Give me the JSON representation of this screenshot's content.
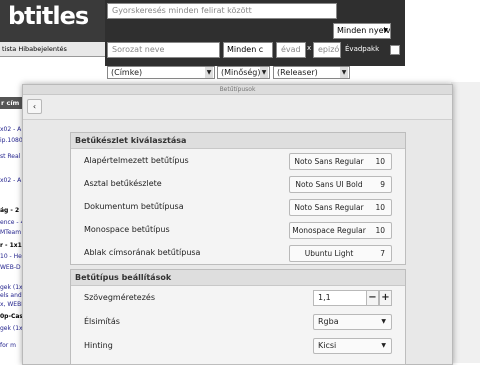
{
  "background": {
    "logo": "btitles",
    "nav": "tista   Hibabejelentés",
    "search_placeholder": "Gyorskeresés minden felirat között",
    "language_select": "Minden nyelv",
    "series_placeholder": "Sorozat neve",
    "category_select": "Minden c",
    "year_placeholder": "évad",
    "x_sep": "x",
    "episode_placeholder": "epizó",
    "season_pack_label": "Évadpakk",
    "filter_tag": "(Címke)",
    "filter_quality": "(Minőség)",
    "filter_releaser": "(Releaser)",
    "left_header": "r cím",
    "left_fragments": [
      "x02 - A",
      "ip.1080",
      "st Real (",
      "x02 - A",
      "ág - 2",
      "ence - 4x0",
      "MTeam",
      "r - 1x1",
      "10 - He",
      "WEB-D",
      "gek (1x",
      "els and",
      "x, WEBR",
      "0p-Cast",
      "gek (1x",
      "for m"
    ]
  },
  "dialog": {
    "title": "Betűtípusok",
    "back_icon": "‹",
    "font_section": {
      "heading": "Betűkészlet kiválasztása",
      "rows": [
        {
          "label": "Alapértelmezett betűtípus",
          "font": "Noto Sans Regular",
          "size": "10"
        },
        {
          "label": "Asztal betűkészlete",
          "font": "Noto Sans UI Bold",
          "size": "9"
        },
        {
          "label": "Dokumentum betűtípusa",
          "font": "Noto Sans Regular",
          "size": "10"
        },
        {
          "label": "Monospace betűtípus",
          "font": "Monospace Regular",
          "size": "10"
        },
        {
          "label": "Ablak címsorának betűtípusa",
          "font": "Ubuntu Light",
          "size": "7"
        }
      ]
    },
    "settings_section": {
      "heading": "Betűtípus beállítások",
      "text_scale_label": "Szövegméretezés",
      "text_scale_value": "1,1",
      "minus": "−",
      "plus": "+",
      "antialias_label": "Élsimítás",
      "antialias_value": "Rgba",
      "hinting_label": "Hinting",
      "hinting_value": "Kicsi"
    }
  }
}
